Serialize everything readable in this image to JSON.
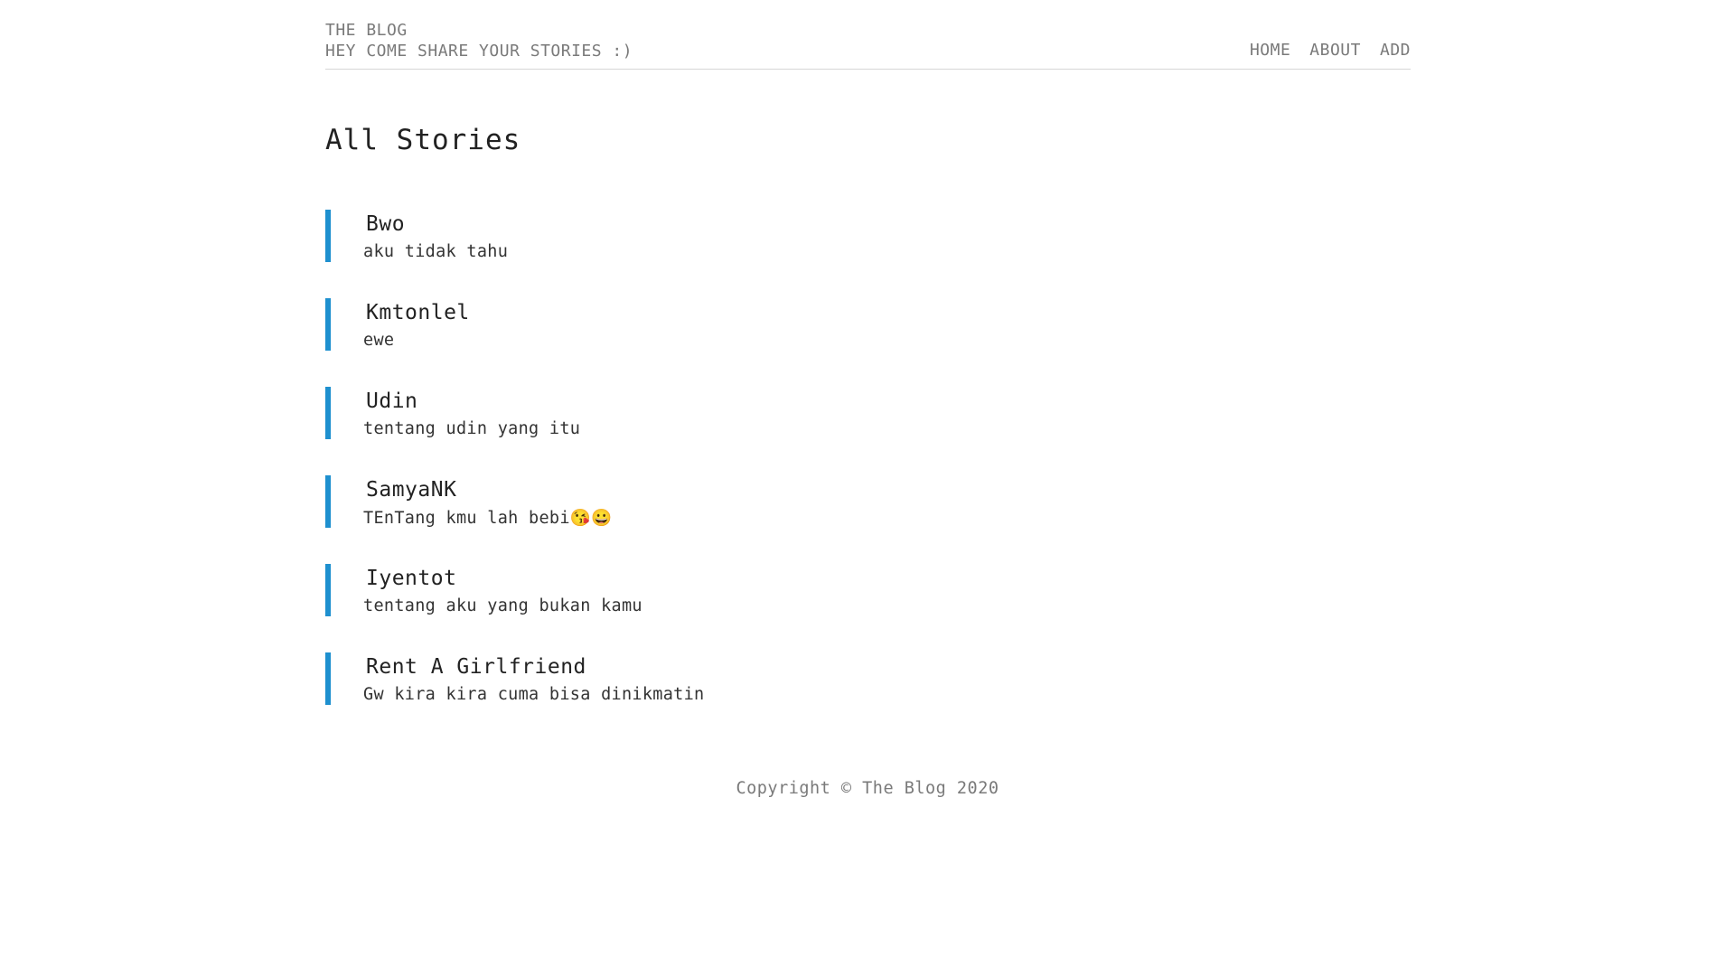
{
  "header": {
    "brand": "THE BLOG",
    "tagline": "HEY COME SHARE YOUR STORIES :)",
    "nav": [
      "HOME",
      "ABOUT",
      "ADD"
    ]
  },
  "main": {
    "title": "All Stories",
    "stories": [
      {
        "title": "Bwo",
        "body": "aku tidak tahu"
      },
      {
        "title": "Kmtonlel",
        "body": "ewe"
      },
      {
        "title": "Udin",
        "body": "tentang udin yang itu"
      },
      {
        "title": "SamyaNK",
        "body": "TEnTang kmu lah bebi😘😀"
      },
      {
        "title": "Iyentot",
        "body": "tentang aku yang bukan kamu"
      },
      {
        "title": "Rent A Girlfriend",
        "body": "Gw kira kira cuma bisa dinikmatin"
      }
    ]
  },
  "footer": {
    "copyright": "Copyright © The Blog 2020"
  },
  "colors": {
    "accent": "#1e90cf",
    "muted": "#7a7a7a"
  }
}
